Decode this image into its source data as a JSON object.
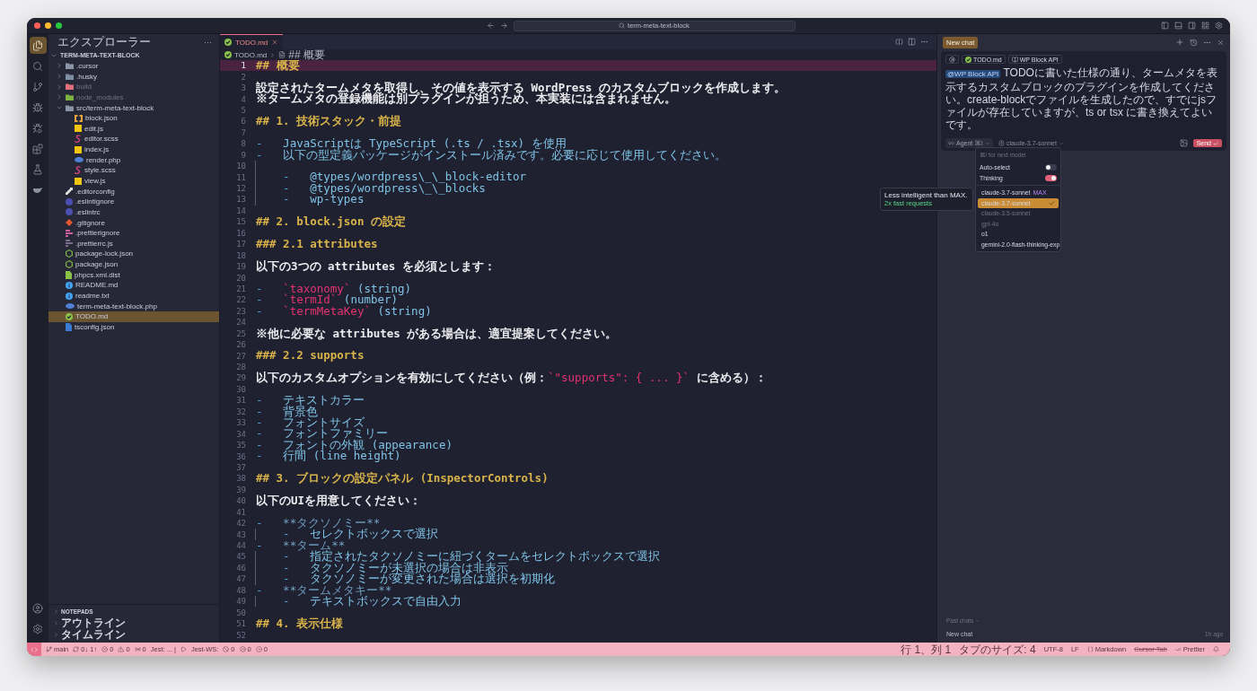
{
  "window": {
    "search": "term-meta-text-block"
  },
  "activity_bar": {
    "top": [
      {
        "kind": "files",
        "selected": true
      },
      {
        "kind": "search",
        "selected": false
      },
      {
        "kind": "branch",
        "selected": false
      },
      {
        "kind": "bug",
        "selected": false
      },
      {
        "kind": "run",
        "selected": false
      },
      {
        "kind": "blocks",
        "selected": false
      },
      {
        "kind": "flask",
        "selected": false
      },
      {
        "kind": "whale",
        "selected": false
      }
    ],
    "bottom": [
      {
        "kind": "account"
      },
      {
        "kind": "settings"
      }
    ]
  },
  "sidebar": {
    "title": "エクスプローラー",
    "more": "···",
    "root": {
      "label": "TERM-META-TEXT-BLOCK",
      "expanded": true
    },
    "items": [
      {
        "label": ".cursor",
        "kind": "folder",
        "color": "#8a96a8",
        "expanded": false,
        "dimmed": false,
        "selected": false
      },
      {
        "label": ".husky",
        "kind": "folder",
        "color": "#7f8fa3",
        "expanded": false,
        "dimmed": false,
        "selected": false
      },
      {
        "label": "build",
        "kind": "folder",
        "color": "#e0707e",
        "expanded": false,
        "dimmed": true,
        "selected": false
      },
      {
        "label": "node_modules",
        "kind": "folder",
        "color": "#7cb342",
        "expanded": false,
        "dimmed": true,
        "selected": false
      },
      {
        "label": "src/term-meta-text-block",
        "kind": "folder",
        "color": "#8a96a8",
        "expanded": true,
        "dimmed": false,
        "selected": false,
        "children": [
          {
            "label": "block.json",
            "kind": "braces",
            "color": "#e8a33d",
            "dimmed": false,
            "selected": false
          },
          {
            "label": "edit.js",
            "kind": "square",
            "color": "#f1c40f",
            "dimmed": false,
            "selected": false
          },
          {
            "label": "editor.scss",
            "kind": "swirl",
            "color": "#d6457e",
            "dimmed": false,
            "selected": false
          },
          {
            "label": "index.js",
            "kind": "square",
            "color": "#f1c40f",
            "dimmed": false,
            "selected": false
          },
          {
            "label": "render.php",
            "kind": "oval",
            "color": "#4f7fd6",
            "dimmed": false,
            "selected": false
          },
          {
            "label": "style.scss",
            "kind": "swirl",
            "color": "#d6457e",
            "dimmed": false,
            "selected": false
          },
          {
            "label": "view.js",
            "kind": "square",
            "color": "#f1c40f",
            "dimmed": false,
            "selected": false
          }
        ]
      },
      {
        "label": ".editorconfig",
        "kind": "wrench",
        "color": "#e0e0e0",
        "dimmed": false,
        "selected": false
      },
      {
        "label": ".eslintignore",
        "kind": "circle",
        "color": "#4b4fb0",
        "dimmed": false,
        "selected": false
      },
      {
        "label": ".eslintrc",
        "kind": "circle",
        "color": "#4b4fb0",
        "dimmed": false,
        "selected": false
      },
      {
        "label": ".gitignore",
        "kind": "diamond",
        "color": "#e2562f",
        "dimmed": false,
        "selected": false
      },
      {
        "label": ".prettierignore",
        "kind": "bars",
        "color": "#d05ca0",
        "dimmed": false,
        "selected": false
      },
      {
        "label": ".prettierrc.js",
        "kind": "bars",
        "color": "#7a6f8a",
        "dimmed": false,
        "selected": false
      },
      {
        "label": "package-lock.json",
        "kind": "hex",
        "color": "#7cb342",
        "dimmed": false,
        "selected": false
      },
      {
        "label": "package.json",
        "kind": "hex",
        "color": "#7cb342",
        "dimmed": false,
        "selected": false
      },
      {
        "label": "phpcs.xml.dist",
        "kind": "file",
        "color": "#8bc34a",
        "dimmed": false,
        "selected": false
      },
      {
        "label": "README.md",
        "kind": "info",
        "color": "#42a5f5",
        "dimmed": false,
        "selected": false
      },
      {
        "label": "readme.txt",
        "kind": "info",
        "color": "#42a5f5",
        "dimmed": false,
        "selected": false
      },
      {
        "label": "term-meta-text-block.php",
        "kind": "oval",
        "color": "#4f7fd6",
        "dimmed": false,
        "selected": false
      },
      {
        "label": "TODO.md",
        "kind": "check",
        "color": "#8bc34a",
        "dimmed": false,
        "selected": true
      },
      {
        "label": "tsconfig.json",
        "kind": "file",
        "color": "#3b7bd0",
        "dimmed": false,
        "selected": false
      }
    ],
    "sections": [
      {
        "label": "NOTEPADS",
        "kind": "caps",
        "expanded": false
      },
      {
        "label": "アウトライン",
        "kind": "plain",
        "expanded": false
      },
      {
        "label": "タイムライン",
        "kind": "plain",
        "expanded": false
      }
    ]
  },
  "tabs": [
    {
      "label": "TODO.md",
      "selected": true
    }
  ],
  "breadcrumb": [
    "TODO.md",
    "## 概要"
  ],
  "lines": [
    {
      "number": "1",
      "current": true,
      "guide": false,
      "parts": [
        {
          "kind": "heading",
          "text": "## 概要"
        }
      ]
    },
    {
      "number": "2",
      "current": false,
      "guide": false
    },
    {
      "number": "3",
      "current": false,
      "guide": false,
      "parts": [
        {
          "kind": "plain",
          "text": "設定されたタームメタを取得し、その値を表示する WordPress のカスタムブロックを作成します。"
        }
      ]
    },
    {
      "number": "4",
      "current": false,
      "guide": false,
      "parts": [
        {
          "kind": "plain",
          "text": "※タームメタの登録機能は別プラグインが担うため、本実装には含まれません。"
        }
      ]
    },
    {
      "number": "5",
      "current": false,
      "guide": false
    },
    {
      "number": "6",
      "current": false,
      "guide": false,
      "parts": [
        {
          "kind": "heading",
          "text": "## 1. 技術スタック・前提"
        }
      ]
    },
    {
      "number": "7",
      "current": false,
      "guide": false
    },
    {
      "number": "8",
      "current": false,
      "guide": false,
      "parts": [
        {
          "kind": "dash",
          "text": "-   "
        },
        {
          "kind": "item",
          "text": "JavaScriptは TypeScript (.ts / .tsx) を使用"
        }
      ]
    },
    {
      "number": "9",
      "current": false,
      "guide": false,
      "parts": [
        {
          "kind": "dash",
          "text": "-   "
        },
        {
          "kind": "item",
          "text": "以下の型定義パッケージがインストール済みです。必要に応じて使用してください。"
        }
      ]
    },
    {
      "number": "10",
      "current": false,
      "guide": true
    },
    {
      "number": "11",
      "current": false,
      "guide": true,
      "parts": [
        {
          "kind": "dash",
          "text": "    -   "
        },
        {
          "kind": "item",
          "text": "@types/wordpress\\_\\_block-editor"
        }
      ]
    },
    {
      "number": "12",
      "current": false,
      "guide": true,
      "parts": [
        {
          "kind": "dash",
          "text": "    -   "
        },
        {
          "kind": "item",
          "text": "@types/wordpress\\_\\_blocks"
        }
      ]
    },
    {
      "number": "13",
      "current": false,
      "guide": true,
      "parts": [
        {
          "kind": "dash",
          "text": "    -   "
        },
        {
          "kind": "item",
          "text": "wp-types"
        }
      ]
    },
    {
      "number": "14",
      "current": false,
      "guide": false
    },
    {
      "number": "15",
      "current": false,
      "guide": false,
      "parts": [
        {
          "kind": "heading",
          "text": "## 2. block.json の設定"
        }
      ]
    },
    {
      "number": "16",
      "current": false,
      "guide": false
    },
    {
      "number": "17",
      "current": false,
      "guide": false,
      "parts": [
        {
          "kind": "heading",
          "text": "### 2.1 attributes"
        }
      ]
    },
    {
      "number": "18",
      "current": false,
      "guide": false
    },
    {
      "number": "19",
      "current": false,
      "guide": false,
      "parts": [
        {
          "kind": "plain",
          "text": "以下の3つの attributes を必須とします："
        }
      ]
    },
    {
      "number": "20",
      "current": false,
      "guide": false
    },
    {
      "number": "21",
      "current": false,
      "guide": false,
      "parts": [
        {
          "kind": "dash",
          "text": "-   "
        },
        {
          "kind": "code",
          "text": "`taxonomy`"
        },
        {
          "kind": "item",
          "text": " (string)"
        }
      ]
    },
    {
      "number": "22",
      "current": false,
      "guide": false,
      "parts": [
        {
          "kind": "dash",
          "text": "-   "
        },
        {
          "kind": "code",
          "text": "`termId`"
        },
        {
          "kind": "item",
          "text": " (number)"
        }
      ]
    },
    {
      "number": "23",
      "current": false,
      "guide": false,
      "parts": [
        {
          "kind": "dash",
          "text": "-   "
        },
        {
          "kind": "code",
          "text": "`termMetaKey`"
        },
        {
          "kind": "item",
          "text": " (string)"
        }
      ]
    },
    {
      "number": "24",
      "current": false,
      "guide": false
    },
    {
      "number": "25",
      "current": false,
      "guide": false,
      "parts": [
        {
          "kind": "plain",
          "text": "※他に必要な attributes がある場合は、適宜提案してください。"
        }
      ]
    },
    {
      "number": "26",
      "current": false,
      "guide": false
    },
    {
      "number": "27",
      "current": false,
      "guide": false,
      "parts": [
        {
          "kind": "heading",
          "text": "### 2.2 supports"
        }
      ]
    },
    {
      "number": "28",
      "current": false,
      "guide": false
    },
    {
      "number": "29",
      "current": false,
      "guide": false,
      "parts": [
        {
          "kind": "plain",
          "text": "以下のカスタムオプションを有効にしてください（例："
        },
        {
          "kind": "code",
          "text": "`\"supports\": { ... }`"
        },
        {
          "kind": "plain",
          "text": " に含める）："
        }
      ]
    },
    {
      "number": "30",
      "current": false,
      "guide": false
    },
    {
      "number": "31",
      "current": false,
      "guide": false,
      "parts": [
        {
          "kind": "dash",
          "text": "-   "
        },
        {
          "kind": "item",
          "text": "テキストカラー"
        }
      ]
    },
    {
      "number": "32",
      "current": false,
      "guide": false,
      "parts": [
        {
          "kind": "dash",
          "text": "-   "
        },
        {
          "kind": "item",
          "text": "背景色"
        }
      ]
    },
    {
      "number": "33",
      "current": false,
      "guide": false,
      "parts": [
        {
          "kind": "dash",
          "text": "-   "
        },
        {
          "kind": "item",
          "text": "フォントサイズ"
        }
      ]
    },
    {
      "number": "34",
      "current": false,
      "guide": false,
      "parts": [
        {
          "kind": "dash",
          "text": "-   "
        },
        {
          "kind": "item",
          "text": "フォントファミリー"
        }
      ]
    },
    {
      "number": "35",
      "current": false,
      "guide": false,
      "parts": [
        {
          "kind": "dash",
          "text": "-   "
        },
        {
          "kind": "item",
          "text": "フォントの外観 (appearance)"
        }
      ]
    },
    {
      "number": "36",
      "current": false,
      "guide": false,
      "parts": [
        {
          "kind": "dash",
          "text": "-   "
        },
        {
          "kind": "item",
          "text": "行間 (line height)"
        }
      ]
    },
    {
      "number": "37",
      "current": false,
      "guide": false
    },
    {
      "number": "38",
      "current": false,
      "guide": false,
      "parts": [
        {
          "kind": "heading",
          "text": "## 3. ブロックの設定パネル (InspectorControls)"
        }
      ]
    },
    {
      "number": "39",
      "current": false,
      "guide": false
    },
    {
      "number": "40",
      "current": false,
      "guide": false,
      "parts": [
        {
          "kind": "plain",
          "text": "以下のUIを用意してください："
        }
      ]
    },
    {
      "number": "41",
      "current": false,
      "guide": false
    },
    {
      "number": "42",
      "current": false,
      "guide": false,
      "parts": [
        {
          "kind": "dash",
          "text": "-   "
        },
        {
          "kind": "strong",
          "text": "**タクソノミー**"
        }
      ]
    },
    {
      "number": "43",
      "current": false,
      "guide": true,
      "parts": [
        {
          "kind": "dash",
          "text": "    -   "
        },
        {
          "kind": "item",
          "text": "セレクトボックスで選択"
        }
      ]
    },
    {
      "number": "44",
      "current": false,
      "guide": false,
      "parts": [
        {
          "kind": "dash",
          "text": "-   "
        },
        {
          "kind": "strong",
          "text": "**ターム**"
        }
      ]
    },
    {
      "number": "45",
      "current": false,
      "guide": true,
      "parts": [
        {
          "kind": "dash",
          "text": "    -   "
        },
        {
          "kind": "item",
          "text": "指定されたタクソノミーに紐づくタームをセレクトボックスで選択"
        }
      ]
    },
    {
      "number": "46",
      "current": false,
      "guide": true,
      "parts": [
        {
          "kind": "dash",
          "text": "    -   "
        },
        {
          "kind": "item",
          "text": "タクソノミーが未選択の場合は非表示"
        }
      ]
    },
    {
      "number": "47",
      "current": false,
      "guide": true,
      "parts": [
        {
          "kind": "dash",
          "text": "    -   "
        },
        {
          "kind": "item",
          "text": "タクソノミーが変更された場合は選択を初期化"
        }
      ]
    },
    {
      "number": "48",
      "current": false,
      "guide": false,
      "parts": [
        {
          "kind": "dash",
          "text": "-   "
        },
        {
          "kind": "strong",
          "text": "**タームメタキー**"
        }
      ]
    },
    {
      "number": "49",
      "current": false,
      "guide": true,
      "parts": [
        {
          "kind": "dash",
          "text": "    -   "
        },
        {
          "kind": "item",
          "text": "テキストボックスで自由入力"
        }
      ]
    },
    {
      "number": "50",
      "current": false,
      "guide": false
    },
    {
      "number": "51",
      "current": false,
      "guide": false,
      "parts": [
        {
          "kind": "heading",
          "text": "## 4. 表示仕様"
        }
      ]
    },
    {
      "number": "52",
      "current": false,
      "guide": false
    }
  ],
  "chat": {
    "tabs": [
      {
        "label": "New chat",
        "selected": true
      }
    ],
    "chips": [
      {
        "kind": "at"
      },
      {
        "kind": "file",
        "label": "TODO.md"
      },
      {
        "kind": "doc",
        "label": "WP Block API"
      }
    ],
    "message": {
      "mention": "@WP Block API",
      "text": "TODOに書いた仕様の通り、タームメタを表示するカスタムブロックのプラグインを作成してください。create-blockでファイルを生成したので、すでにjsファイルが存在していますが、ts or tsx に書き換えてよいです。"
    },
    "mode": {
      "label": "Agent",
      "shortcut": "⌘I"
    },
    "model": "claude-3.7-sonnet",
    "send": "Send",
    "model_menu": {
      "placeholder": "⌘/ for next model",
      "toggles": [
        {
          "label": "Auto-select",
          "on": false
        },
        {
          "label": "Thinking",
          "on": true
        }
      ],
      "models": [
        {
          "label": "claude-3.7-sonnet",
          "badge": "MAX",
          "selected": false,
          "dimmed": false
        },
        {
          "label": "claude-3.7-sonnet",
          "selected": true,
          "dimmed": false
        },
        {
          "label": "claude-3.5-sonnet",
          "selected": false,
          "dimmed": true
        },
        {
          "label": "gpt-4o",
          "selected": false,
          "dimmed": true
        },
        {
          "label": "o1",
          "selected": false,
          "dimmed": false
        },
        {
          "label": "gemini-2.0-flash-thinking-exp",
          "selected": false,
          "dimmed": false
        }
      ]
    },
    "tooltip": {
      "title": "Less intelligent than MAX.",
      "note": "2x fast requests"
    },
    "past_chats": {
      "label": "Past chats",
      "items": [
        {
          "title": "New chat",
          "time": "1h ago"
        }
      ]
    }
  },
  "status_bar": {
    "left": [
      {
        "kind": "remote"
      },
      {
        "kind": "branch",
        "text": "main"
      },
      {
        "kind": "sync",
        "text": "0↓ 1↑"
      },
      {
        "kind": "error",
        "text": "0"
      },
      {
        "kind": "warning",
        "text": "0"
      },
      {
        "kind": "ports",
        "text": "0"
      },
      {
        "kind": "plain",
        "text": "Jest: ... |"
      },
      {
        "kind": "play"
      },
      {
        "kind": "plain",
        "text": "Jest-WS:"
      },
      {
        "kind": "skipped",
        "text": "0"
      },
      {
        "kind": "error",
        "text": "0"
      },
      {
        "kind": "pending",
        "text": "0"
      }
    ],
    "right": [
      {
        "kind": "label",
        "text": "行 1、列 1"
      },
      {
        "kind": "label",
        "text": "タブのサイズ: 4"
      },
      {
        "kind": "plain",
        "text": "UTF-8"
      },
      {
        "kind": "plain",
        "text": "LF"
      },
      {
        "kind": "braces",
        "text": "Markdown"
      },
      {
        "kind": "struck",
        "text": "Cursor Tab"
      },
      {
        "kind": "checks",
        "text": "Prettier"
      },
      {
        "kind": "bell"
      }
    ]
  }
}
